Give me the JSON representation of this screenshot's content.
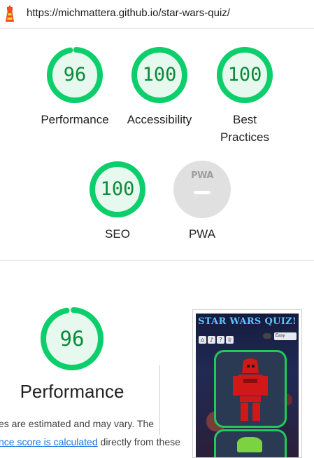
{
  "browser": {
    "url": "https://michmattera.github.io/star-wars-quiz/"
  },
  "summary": {
    "gauges": [
      {
        "score": "96",
        "label": "Performance",
        "value": 0.96
      },
      {
        "score": "100",
        "label": "Accessibility",
        "value": 1.0
      },
      {
        "score": "100",
        "label": "Best Practices",
        "value": 1.0
      },
      {
        "score": "100",
        "label": "SEO",
        "value": 1.0
      }
    ],
    "pwa": {
      "logo": "PWA",
      "label": "PWA"
    }
  },
  "performance": {
    "score": "96",
    "value": 0.96,
    "title": "Performance",
    "desc_line1": "es are estimated and may vary. The",
    "desc_link": "nce score is calculated",
    "desc_line2_rest": " directly from these"
  },
  "screenshot": {
    "title": "STAR WARS QUIZ!",
    "icons": [
      "home-icon",
      "music-icon",
      "help-icon",
      "trophy-icon"
    ],
    "select_value": "Easy"
  },
  "colors": {
    "pass_green": "#0cce6b",
    "pass_fill": "#e7f8ee",
    "score_text": "#0b8a3b",
    "link": "#1a73e8"
  }
}
